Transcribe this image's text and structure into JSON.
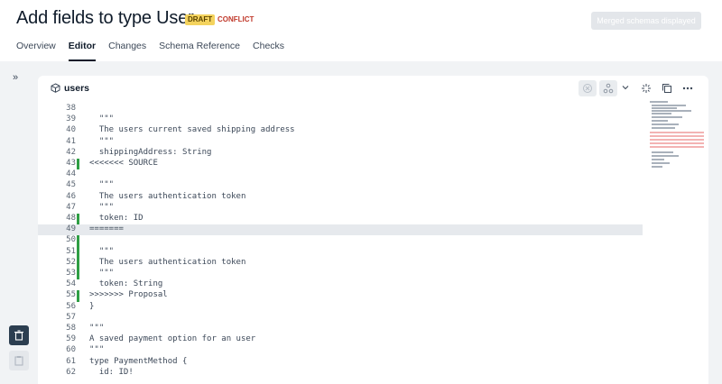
{
  "header": {
    "title": "Add fields to type User",
    "badge_draft": "DRAFT",
    "badge_conflict": "CONFLICT",
    "merged_button": "Merged schemas displayed"
  },
  "tabs": [
    "Overview",
    "Editor",
    "Changes",
    "Schema Reference",
    "Checks"
  ],
  "active_tab": "Editor",
  "panel": {
    "title": "users"
  },
  "code_lines": [
    {
      "n": "38",
      "t": ""
    },
    {
      "n": "39",
      "t": "  \"\"\""
    },
    {
      "n": "40",
      "t": "  The users current saved shipping address"
    },
    {
      "n": "41",
      "t": "  \"\"\""
    },
    {
      "n": "42",
      "t": "  shippingAddress: String"
    },
    {
      "n": "43",
      "t": "<<<<<<< SOURCE"
    },
    {
      "n": "44",
      "t": ""
    },
    {
      "n": "45",
      "t": "  \"\"\""
    },
    {
      "n": "46",
      "t": "  The users authentication token"
    },
    {
      "n": "47",
      "t": "  \"\"\""
    },
    {
      "n": "48",
      "t": "  token: ID"
    },
    {
      "n": "49",
      "t": "======="
    },
    {
      "n": "50",
      "t": ""
    },
    {
      "n": "51",
      "t": "  \"\"\""
    },
    {
      "n": "52",
      "t": "  The users authentication token"
    },
    {
      "n": "53",
      "t": "  \"\"\""
    },
    {
      "n": "54",
      "t": "  token: String"
    },
    {
      "n": "55",
      "t": ">>>>>>> Proposal"
    },
    {
      "n": "56",
      "t": "}"
    },
    {
      "n": "57",
      "t": ""
    },
    {
      "n": "58",
      "t": "\"\"\""
    },
    {
      "n": "59",
      "t": "A saved payment option for an user"
    },
    {
      "n": "60",
      "t": "\"\"\""
    },
    {
      "n": "61",
      "t": "type PaymentMethod {"
    },
    {
      "n": "62",
      "t": "  id: ID!"
    }
  ],
  "colors": {
    "draft_badge": "#f4d35e",
    "conflict_text": "#c0392b",
    "conflict_gutter": "#2f9e44",
    "keyword": "#2456b8",
    "type": "#8e44ad"
  },
  "icons": {
    "sidebar_expand": "double-chevron-right-icon",
    "type": "cube-icon",
    "toolbar": [
      "close-circle-icon",
      "graph-icon",
      "chevron-down-icon",
      "sparkle-icon",
      "copy-icon",
      "more-icon"
    ],
    "sidebar_bottom": [
      "trash-icon",
      "clipboard-icon"
    ]
  }
}
